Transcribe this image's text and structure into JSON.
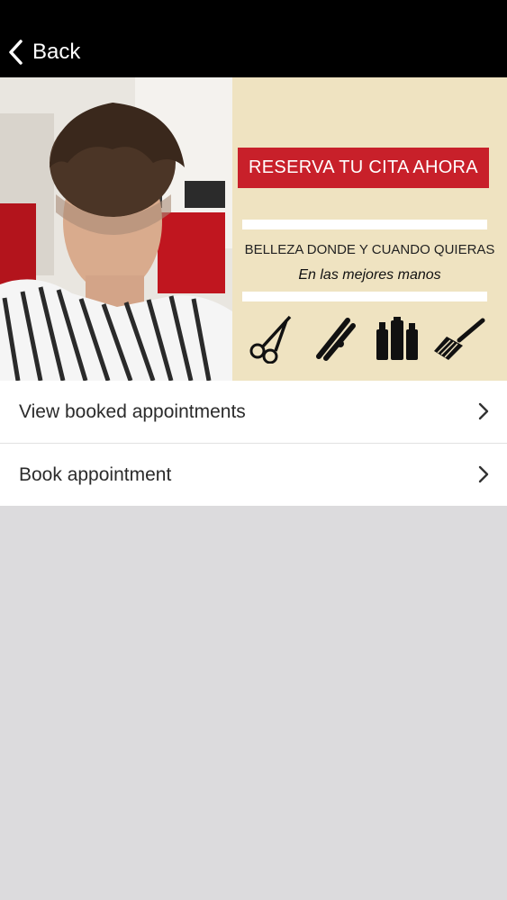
{
  "header": {
    "back_label": "Back"
  },
  "banner": {
    "cta": "RESERVA TU CITA AHORA",
    "tagline": "BELLEZA DONDE Y CUANDO QUIERAS",
    "subline": "En las mejores manos",
    "colors": {
      "cta_red": "#c8202a",
      "cream": "#efe3c1"
    },
    "tool_icons": [
      "scissors-icon",
      "hair-straightener-icon",
      "bottles-icon",
      "dye-brush-icon"
    ]
  },
  "menu": {
    "items": [
      {
        "label": "View booked appointments"
      },
      {
        "label": "Book appointment"
      }
    ]
  }
}
